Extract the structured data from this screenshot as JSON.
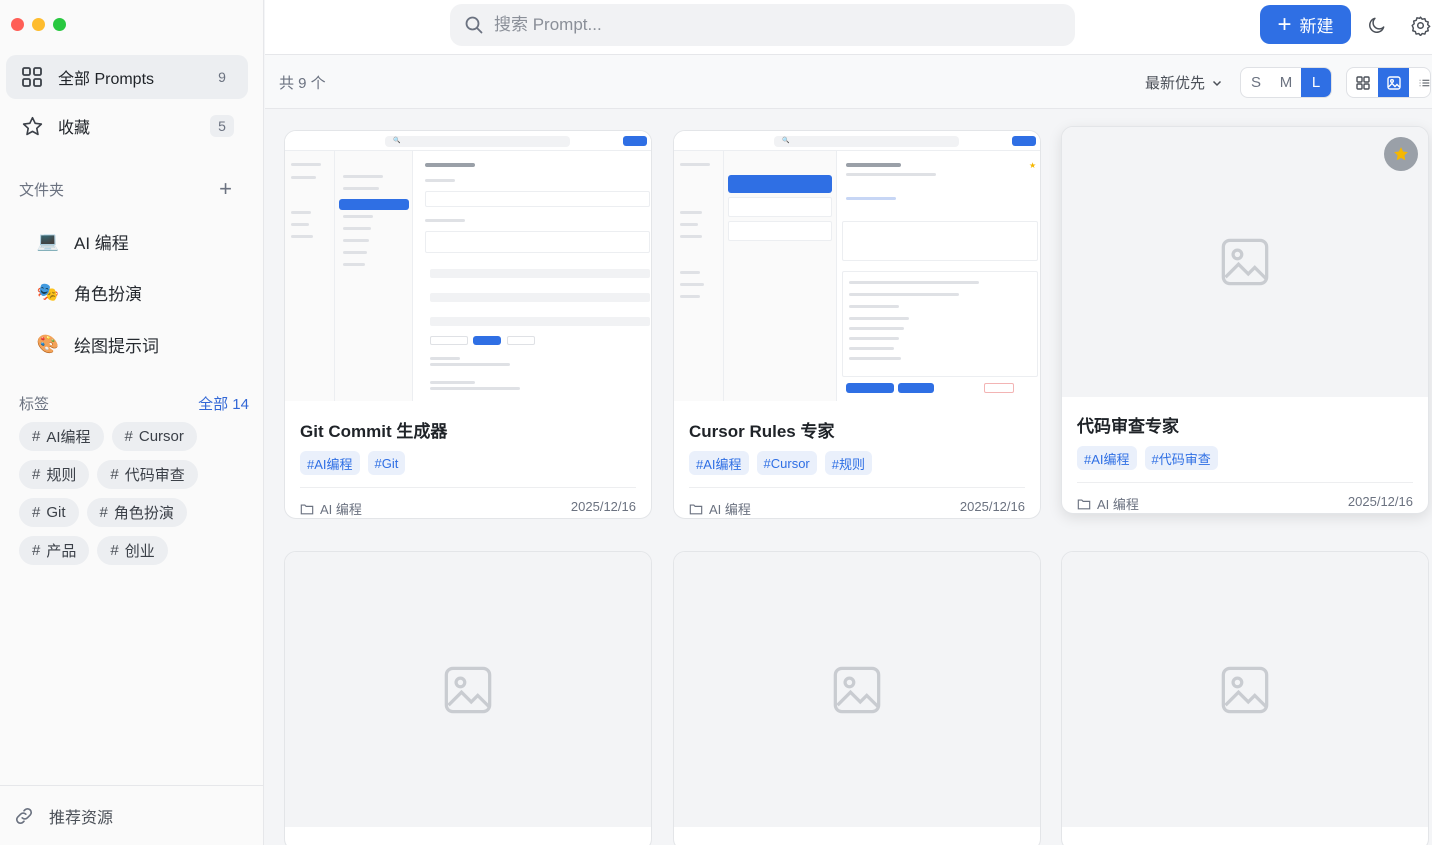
{
  "window": {
    "traffic_colors": [
      "#ff5f57",
      "#febc2e",
      "#28c840"
    ]
  },
  "sidebar": {
    "nav": [
      {
        "label": "全部 Prompts",
        "count": "9",
        "icon": "grid-icon"
      },
      {
        "label": "收藏",
        "count": "5",
        "icon": "star-icon"
      }
    ],
    "folders_title": "文件夹",
    "folders": [
      {
        "label": "AI 编程",
        "icon": "💻"
      },
      {
        "label": "角色扮演",
        "icon": "🎭"
      },
      {
        "label": "绘图提示词",
        "icon": "🎨"
      }
    ],
    "tags_title": "标签",
    "tags_all": "全部 14",
    "tags": [
      "AI编程",
      "Cursor",
      "规则",
      "代码审查",
      "Git",
      "角色扮演",
      "产品",
      "创业"
    ],
    "footer_label": "推荐资源"
  },
  "topbar": {
    "search_placeholder": "搜索 Prompt...",
    "new_label": "新建"
  },
  "toolbar": {
    "total": "共 9 个",
    "sort_label": "最新优先",
    "sizes": [
      "S",
      "M",
      "L"
    ],
    "active_size": "L"
  },
  "cards": [
    {
      "title": "Git Commit 生成器",
      "tags": [
        "#AI编程",
        "#Git"
      ],
      "folder": "AI 编程",
      "date": "2025/12/16"
    },
    {
      "title": "Cursor Rules 专家",
      "tags": [
        "#AI编程",
        "#Cursor",
        "#规则"
      ],
      "folder": "AI 编程",
      "date": "2025/12/16"
    },
    {
      "title": "代码审查专家",
      "tags": [
        "#AI编程",
        "#代码审查"
      ],
      "folder": "AI 编程",
      "date": "2025/12/16",
      "favorite": true
    }
  ],
  "colors": {
    "accent": "#2f6fe4",
    "tag_bg": "#eaf0fb",
    "star": "#f5b700"
  }
}
